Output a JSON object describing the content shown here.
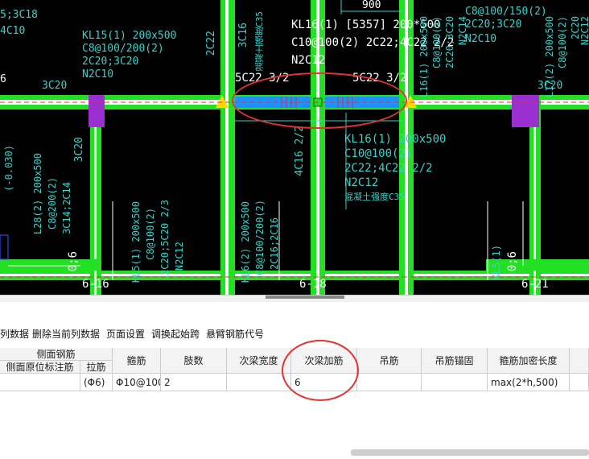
{
  "cad": {
    "labels": {
      "top_left_1": "5;3C18",
      "top_left_2": "4C10",
      "kl15_1": "KL15(1) 200x500",
      "kl15_2": "C8@100/200(2)",
      "kl15_3": "2C20;3C20",
      "kl15_4": "N2C10",
      "left_6": "6",
      "left_3c20": "3C20",
      "dim_900": "900",
      "kl16_white_1": "KL16(1) [5357] 200*500",
      "kl16_white_2": "C10@100(2) 2C22;4C22 2/2",
      "kl16_white_3": "N2C12",
      "rebar_left": "5C22 3/2",
      "rebar_right": "5C22 3/2",
      "v_2c22": "2C22",
      "v_3c16": "3C16",
      "v_c35": "混凝土强度C35",
      "right_top_1": "C8@100/150(2)",
      "right_top_2": "2C20;3C20",
      "right_top_3": "N2C10",
      "right_3c20": "3C20",
      "kl16_cyan_1": "KL16(1) 200x500",
      "kl16_cyan_2": "C10@100(2)",
      "kl16_cyan_3": "2C22;4C22 2/2",
      "kl16_cyan_4": "N2C12",
      "kl16_cyan_5": "混凝土强度C35",
      "v_4c16": "4C16 2/2",
      "v_3c20": "3C20",
      "l28_1": "L28(2) 200x500",
      "l28_2": "C8@200(2)",
      "l28_3": "3C14;2C14",
      "left_neg": "(-0.030)",
      "kl5_1": "KL5(1) 200x500",
      "kl5_2": "C8@100(2)",
      "kl5_3": "2C20;5C20 2/3",
      "kl5_4": "N2C12",
      "kl6_1": "KL6(2) 200x500",
      "kl6_2": "C8@100/200(2)",
      "kl6_3": "2C16;2C16",
      "kl5r": "KL5(1)",
      "axis_616": "6-16",
      "axis_618": "6-18",
      "axis_621": "6-21",
      "dim_06_left": "0;6",
      "dim_06_right": "0;6",
      "side_l16": "L16(1) 200x500",
      "side_l16b": "C8@100(2)",
      "side_l16c": "2C20;3C20",
      "side_l16d": "N2C14",
      "far_right": "L17(2) 200x500",
      "far_right_2": "C8@100(2)",
      "far_right_3": "2C20",
      "far_right_4": "N2C12"
    }
  },
  "toolbar": {
    "items": [
      "列数据",
      "删除当前列数据",
      "页面设置",
      "调换起始跨",
      "悬臂钢筋代号"
    ]
  },
  "grid": {
    "group_header": "侧面钢筋",
    "sub_header_1": "侧面原位标注筋",
    "sub_header_2": "拉筋",
    "columns": [
      "箍筋",
      "肢数",
      "次梁宽度",
      "次梁加筋",
      "吊筋",
      "吊筋锚固",
      "箍筋加密长度"
    ],
    "row": {
      "side_bar": "",
      "tie_bar": "(Φ6)",
      "stirrup": "Φ10@100",
      "legs": "2",
      "sec_width": "",
      "sec_rebar": "6",
      "hanger": "",
      "hanger_anchor": "",
      "dense_len": "max(2*h,500)"
    }
  },
  "colors": {
    "beam_green": "#22e022",
    "beam_blue": "#1e90ff",
    "cad_cyan": "#39d1c9",
    "column_purple": "#9b30d0",
    "annotation_red": "#e53232"
  }
}
